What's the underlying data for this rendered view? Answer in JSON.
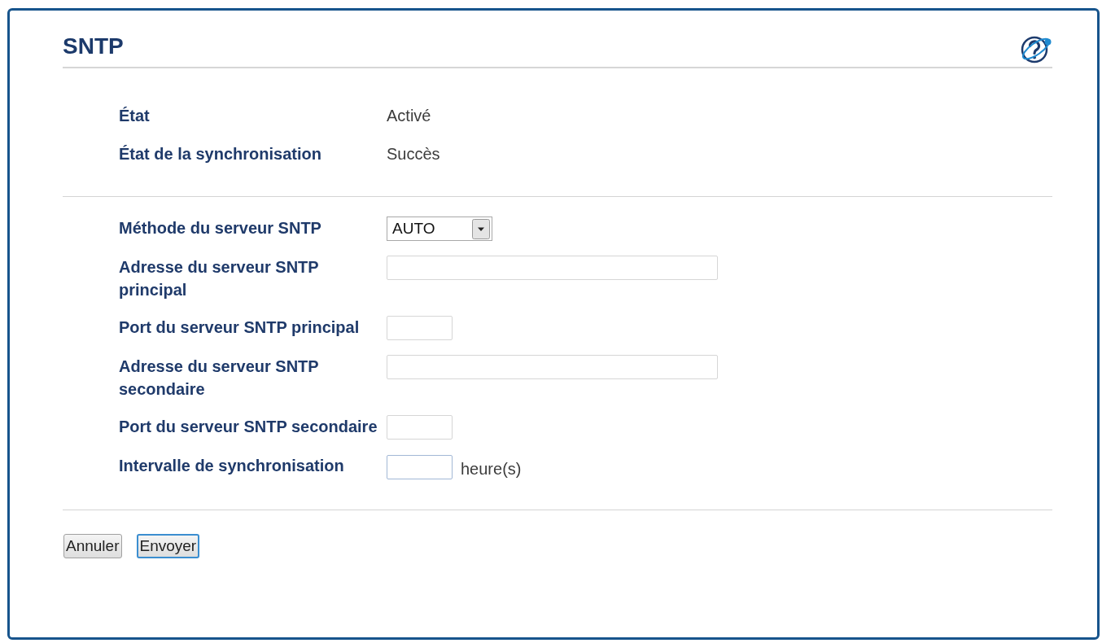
{
  "page": {
    "title": "SNTP"
  },
  "status": [
    {
      "label": "État",
      "value": "Activé"
    },
    {
      "label": "État de la synchronisation",
      "value": "Succès"
    }
  ],
  "fields": [
    {
      "label": "Méthode du serveur SNTP",
      "kind": "select",
      "value": "AUTO",
      "highlighted": false
    },
    {
      "label": "Adresse du serveur SNTP principal",
      "kind": "text",
      "highlighted": false
    },
    {
      "label": "Port du serveur SNTP principal",
      "kind": "number",
      "highlighted": false
    },
    {
      "label": "Adresse du serveur SNTP secondaire",
      "kind": "text",
      "highlighted": false
    },
    {
      "label": "Port du serveur SNTP secondaire",
      "kind": "number",
      "highlighted": false
    },
    {
      "label": "Intervalle de synchronisation",
      "kind": "number",
      "unit": "heure(s)",
      "highlighted": true
    }
  ],
  "buttons": [
    {
      "label": "Annuler",
      "focused": false
    },
    {
      "label": "Envoyer",
      "focused": true
    }
  ]
}
